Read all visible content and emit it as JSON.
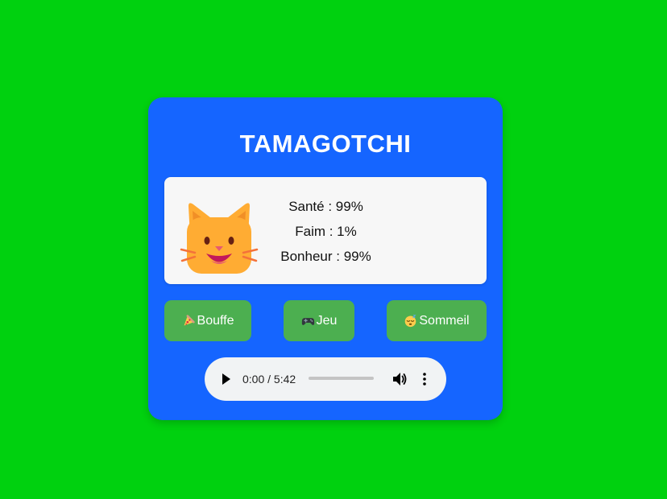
{
  "title": "TAMAGOTCHI",
  "pet": {
    "icon": "cat-face-icon"
  },
  "stats": {
    "health": "Santé : 99%",
    "hunger": "Faim : 1%",
    "happiness": "Bonheur : 99%"
  },
  "buttons": {
    "food_label": "Bouffe",
    "food_icon": "pizza-icon",
    "play_label": "Jeu",
    "play_icon": "game-controller-icon",
    "sleep_label": "Sommeil",
    "sleep_icon": "sleeping-face-icon"
  },
  "audio": {
    "time": "0:00 / 5:42",
    "progress": 0
  },
  "colors": {
    "background": "#00d10f",
    "card": "#1565ff",
    "button": "#4caf50",
    "panel": "#f7f7f7"
  }
}
